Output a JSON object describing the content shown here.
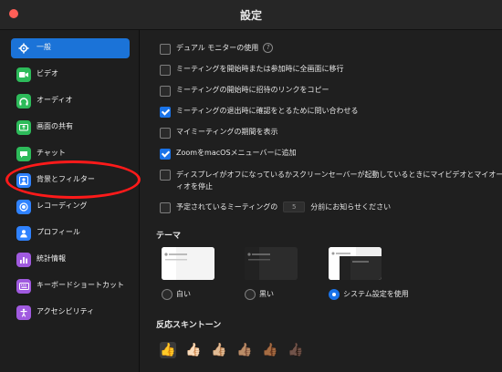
{
  "window": {
    "title": "設定"
  },
  "sidebar": {
    "items": [
      {
        "label": "一般",
        "icon": "gear-icon",
        "color": "#2f82ff",
        "active": true
      },
      {
        "label": "ビデオ",
        "icon": "video-icon",
        "color": "#2dbb5a"
      },
      {
        "label": "オーディオ",
        "icon": "headphone-icon",
        "color": "#2dbb5a"
      },
      {
        "label": "画面の共有",
        "icon": "share-screen-icon",
        "color": "#2dbb5a"
      },
      {
        "label": "チャット",
        "icon": "chat-icon",
        "color": "#2dbb5a"
      },
      {
        "label": "背景とフィルター",
        "icon": "person-background-icon",
        "color": "#2f82ff"
      },
      {
        "label": "レコーディング",
        "icon": "record-icon",
        "color": "#2f82ff"
      },
      {
        "label": "プロフィール",
        "icon": "profile-icon",
        "color": "#2f82ff"
      },
      {
        "label": "統計情報",
        "icon": "stats-icon",
        "color": "#a05adf"
      },
      {
        "label": "キーボードショートカット",
        "icon": "keyboard-icon",
        "color": "#a05adf"
      },
      {
        "label": "アクセシビリティ",
        "icon": "accessibility-icon",
        "color": "#a05adf"
      }
    ]
  },
  "options": [
    {
      "label": "デュアル モニターの使用",
      "checked": false,
      "help": "?"
    },
    {
      "label": "ミーティングを開始時または参加時に全画面に移行",
      "checked": false
    },
    {
      "label": "ミーティングの開始時に招待のリンクをコピー",
      "checked": false
    },
    {
      "label": "ミーティングの退出時に確認をとるために問い合わせる",
      "checked": true
    },
    {
      "label": "マイミーティングの期間を表示",
      "checked": false
    },
    {
      "label": "ZoomをmacOSメニューバーに追加",
      "checked": true
    },
    {
      "label": "ディスプレイがオフになっているかスクリーンセーバーが起動しているときにマイビデオとマイオーディオを停止",
      "checked": false
    },
    {
      "label_before": "予定されているミーティングの",
      "stepper_value": "5",
      "label_after": "分前にお知らせください",
      "checked": false
    }
  ],
  "theme": {
    "title": "テーマ",
    "choices": [
      {
        "label": "白い",
        "selected": false
      },
      {
        "label": "黒い",
        "selected": false
      },
      {
        "label": "システム設定を使用",
        "selected": true
      }
    ]
  },
  "skin_tone": {
    "title": "反応スキントーン",
    "tones": [
      "👍",
      "👍🏻",
      "👍🏼",
      "👍🏽",
      "👍🏾",
      "👍🏿"
    ],
    "selected_index": 0
  },
  "colors": {
    "accent": "#1a73e8",
    "annotation": "#ff1a1a"
  }
}
